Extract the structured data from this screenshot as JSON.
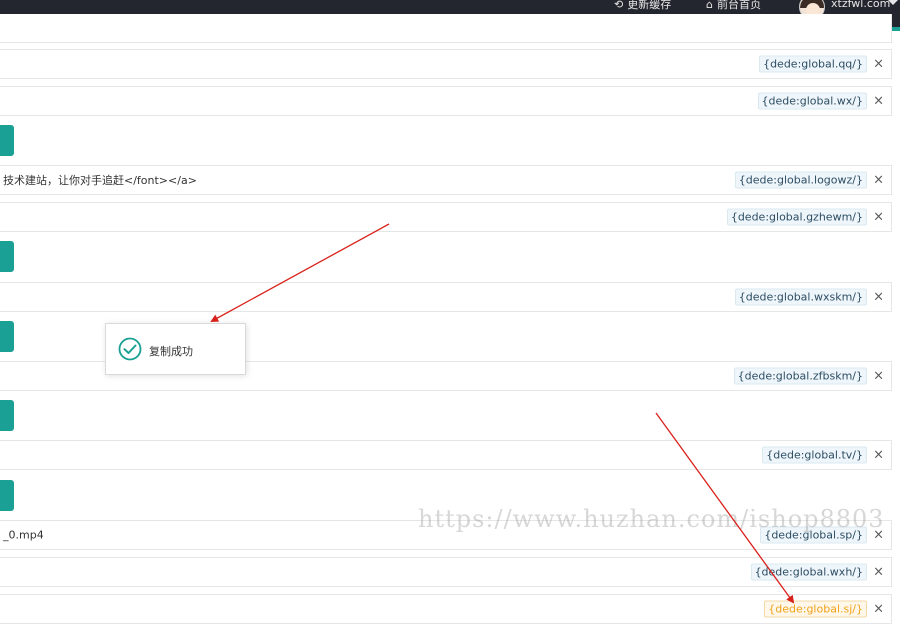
{
  "header": {
    "refresh_cache": "更新缓存",
    "home": "前台首页",
    "username": "xtzfwl.com"
  },
  "rows": {
    "r0": {
      "tag": "{dede:global.qq/}"
    },
    "r1": {
      "tag": "{dede:global.wx/}"
    },
    "r2": {
      "text": "技术建站，让你对手追赶</font></a>",
      "tag": "{dede:global.logowz/}"
    },
    "r3": {
      "tag": "{dede:global.gzhewm/}"
    },
    "r4": {
      "tag": "{dede:global.wxskm/}"
    },
    "r5": {
      "tag": "{dede:global.zfbskm/}"
    },
    "r6": {
      "tag": "{dede:global.tv/}"
    },
    "r7": {
      "text": "_0.mp4",
      "tag": "{dede:global.sp/}"
    },
    "r8": {
      "tag": "{dede:global.wxh/}"
    },
    "r9": {
      "tag": "{dede:global.sj/}"
    }
  },
  "toast": {
    "message": "复制成功"
  },
  "watermark": "https://www.huzhan.com/ishop8803",
  "icons": {
    "close": "×",
    "refresh": "refresh-icon",
    "home": "home-icon",
    "check": "check-circle-icon"
  },
  "colors": {
    "accent": "#1aa094",
    "topbar": "#23262e",
    "highlight_tag": "#f0a21a",
    "arrow": "#d9211b"
  }
}
